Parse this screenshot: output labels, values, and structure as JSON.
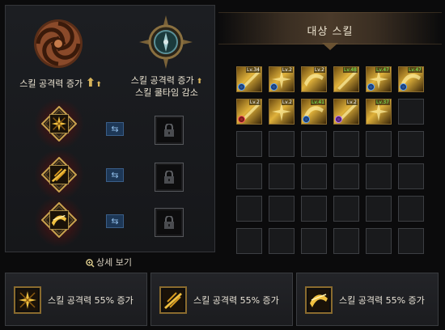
{
  "left_panel": {
    "option_left_label": "스킬 공격력 증가",
    "option_right_line1": "스킬 공격력 증가",
    "option_right_line2": "스킬 쿨타임 감소",
    "detail_link": "상세 보기"
  },
  "right_panel": {
    "header_title": "대상 스킬",
    "grid_rows": [
      [
        {
          "filled": true,
          "level": "Lv.34",
          "level_color": "white",
          "badge": "blue"
        },
        {
          "filled": true,
          "level": "Lv.2",
          "level_color": "white",
          "badge": "blue"
        },
        {
          "filled": true,
          "level": "Lv.2",
          "level_color": "white",
          "badge": ""
        },
        {
          "filled": true,
          "level": "Lv.48",
          "level_color": "green",
          "badge": ""
        },
        {
          "filled": true,
          "level": "Lv.47",
          "level_color": "green",
          "badge": "blue"
        },
        {
          "filled": true,
          "level": "Lv.47",
          "level_color": "green",
          "badge": "blue"
        }
      ],
      [
        {
          "filled": true,
          "level": "Lv.2",
          "level_color": "white",
          "badge": "red"
        },
        {
          "filled": true,
          "level": "Lv.2",
          "level_color": "white",
          "badge": ""
        },
        {
          "filled": true,
          "level": "Lv.41",
          "level_color": "green",
          "badge": "blue"
        },
        {
          "filled": true,
          "level": "Lv.2",
          "level_color": "white",
          "badge": "purple"
        },
        {
          "filled": true,
          "level": "Lv.37",
          "level_color": "green",
          "badge": ""
        },
        {
          "filled": false
        }
      ],
      [
        {
          "filled": false
        },
        {
          "filled": false
        },
        {
          "filled": false
        },
        {
          "filled": false
        },
        {
          "filled": false
        },
        {
          "filled": false
        }
      ],
      [
        {
          "filled": false
        },
        {
          "filled": false
        },
        {
          "filled": false
        },
        {
          "filled": false
        },
        {
          "filled": false
        },
        {
          "filled": false
        }
      ],
      [
        {
          "filled": false
        },
        {
          "filled": false
        },
        {
          "filled": false
        },
        {
          "filled": false
        },
        {
          "filled": false
        },
        {
          "filled": false
        }
      ],
      [
        {
          "filled": false
        },
        {
          "filled": false
        },
        {
          "filled": false
        },
        {
          "filled": false
        },
        {
          "filled": false
        },
        {
          "filled": false
        }
      ]
    ]
  },
  "bottom_cards": [
    {
      "text": "스킬 공격력 55% 증가"
    },
    {
      "text": "스킬 공격력 55% 증가"
    },
    {
      "text": "스킬 공격력 55% 증가"
    }
  ],
  "colors": {
    "accent_gold": "#d7b35a",
    "swap_blue": "#1d3756",
    "cell_border": "#3d3f43"
  }
}
